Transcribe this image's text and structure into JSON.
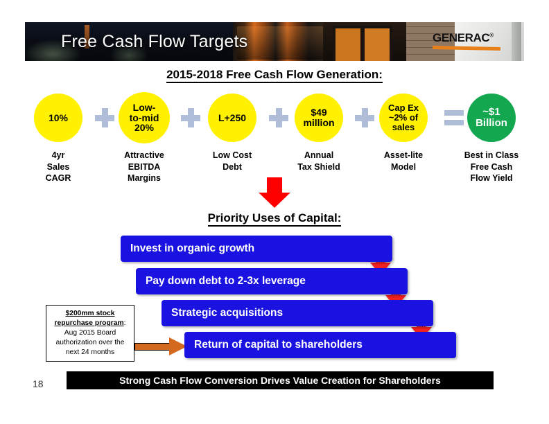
{
  "header": {
    "title": "Free Cash Flow Targets",
    "logo_text": "GENERAC",
    "logo_trademark": "®"
  },
  "fcf_section": {
    "heading": "2015-2018 Free Cash Flow Generation:",
    "circles": [
      {
        "lines": [
          "10%"
        ],
        "color": "#FFF100",
        "text_color": "#000000",
        "caption": [
          "4yr",
          "Sales",
          "CAGR"
        ]
      },
      {
        "lines": [
          "Low-",
          "to-mid",
          "20%"
        ],
        "color": "#FFF100",
        "text_color": "#000000",
        "caption": [
          "Attractive",
          "EBITDA",
          "Margins"
        ]
      },
      {
        "lines": [
          "L+250"
        ],
        "color": "#FFF100",
        "text_color": "#000000",
        "caption": [
          "Low Cost",
          "Debt"
        ]
      },
      {
        "lines": [
          "$49",
          "million"
        ],
        "color": "#FFF100",
        "text_color": "#000000",
        "caption": [
          "Annual",
          "Tax Shield"
        ]
      },
      {
        "lines": [
          "Cap Ex",
          "~2% of",
          "sales"
        ],
        "color": "#FFF100",
        "text_color": "#000000",
        "caption": [
          "Asset-lite",
          "Model"
        ]
      },
      {
        "lines": [
          "~$1",
          "Billion"
        ],
        "color": "#13A850",
        "text_color": "#FFFFFF",
        "caption": [
          "Best in Class",
          "Free Cash",
          "Flow Yield"
        ]
      }
    ],
    "operators": [
      "+",
      "+",
      "+",
      "+",
      "="
    ]
  },
  "priority_section": {
    "heading": "Priority Uses of Capital:",
    "bars": [
      {
        "label": "Invest in organic growth"
      },
      {
        "label": "Pay down debt to  2-3x leverage"
      },
      {
        "label": "Strategic acquisitions"
      },
      {
        "label": "Return of capital to shareholders"
      }
    ],
    "bar_color": "#1A12E0",
    "arrow_color": "#F22020"
  },
  "callout": {
    "title": "$200mm stock repurchase program",
    "colon": ":",
    "body": "Aug 2015 Board authorization over the next 24 months",
    "arrow_color": "#D2691E"
  },
  "footer": {
    "tagline": "Strong Cash Flow Conversion Drives Value Creation for Shareholders",
    "slide_number": "18"
  }
}
